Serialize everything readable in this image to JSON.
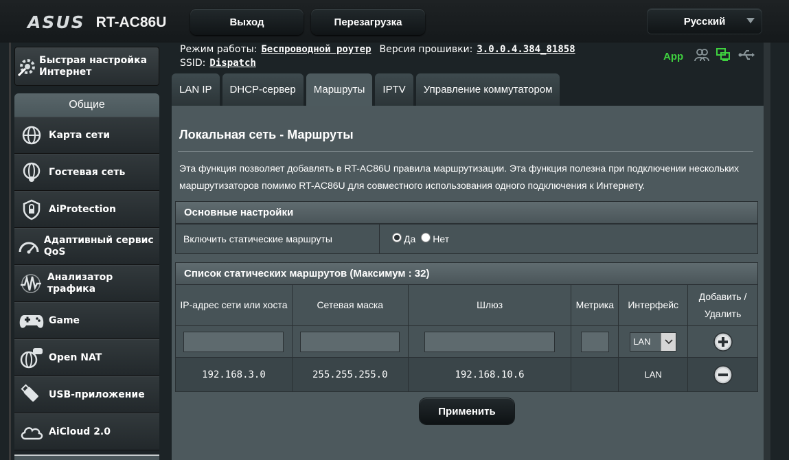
{
  "header": {
    "brand": "ASUS",
    "model": "RT-AC86U",
    "logout_label": "Выход",
    "reboot_label": "Перезагрузка",
    "language": "Русский"
  },
  "info": {
    "mode_label": "Режим работы:",
    "mode_value": "Беспроводной роутер",
    "firmware_label": "Версия прошивки:",
    "firmware_value": "3.0.0.4.384_81858",
    "ssid_label": "SSID:",
    "ssid_value": "Dispatch",
    "app_label": "App"
  },
  "sidebar": {
    "quick_setup": "Быстрая настройка Интернет",
    "section_label": "Общие",
    "items": [
      {
        "label": "Карта сети",
        "icon": "globe-network-icon"
      },
      {
        "label": "Гостевая сеть",
        "icon": "guest-network-icon"
      },
      {
        "label": "AiProtection",
        "icon": "shield-lock-icon"
      },
      {
        "label": "Адаптивный сервис QoS",
        "icon": "speedometer-icon"
      },
      {
        "label": "Анализатор трафика",
        "icon": "traffic-wave-icon"
      },
      {
        "label": "Game",
        "icon": "gamepad-icon"
      },
      {
        "label": "Open NAT",
        "icon": "open-nat-icon"
      },
      {
        "label": "USB-приложение",
        "icon": "usb-drive-icon"
      },
      {
        "label": "AiCloud 2.0",
        "icon": "cloud-icon"
      }
    ]
  },
  "tabs": [
    "LAN IP",
    "DHCP-сервер",
    "Маршруты",
    "IPTV",
    "Управление коммутатором"
  ],
  "active_tab": "Маршруты",
  "page": {
    "title": "Локальная сеть - Маршруты",
    "description": "Эта функция позволяет добавлять в RT-AC86U правила маршрутизации. Эта функция полезна при подключении нескольких маршрутизаторов помимо RT-AC86U для совместного использования одного подключения к Интернету.",
    "basic_section": "Основные настройки",
    "static_routes_label": "Включить статические маршруты",
    "option_yes": "Да",
    "option_no": "Нет",
    "static_routes_enabled": true,
    "list_section": "Список статических маршрутов (Максимум : 32)",
    "columns": [
      "IP-адрес сети или хоста",
      "Сетевая маска",
      "Шлюз",
      "Метрика",
      "Интерфейс",
      "Добавить / Удалить"
    ],
    "new_interface": "LAN",
    "routes": [
      {
        "ip": "192.168.3.0",
        "mask": "255.255.255.0",
        "gateway": "192.168.10.6",
        "metric": "",
        "interface": "LAN"
      }
    ],
    "apply_label": "Применить"
  }
}
